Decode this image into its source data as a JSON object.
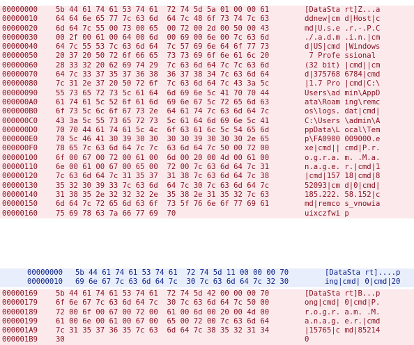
{
  "colors": {
    "pink_bg": "#fbe9ec",
    "pink_text": "#8a1524",
    "blue_bg": "#e8eefb",
    "blue_text": "#0a1f86"
  },
  "blocks": [
    {
      "style": "pink",
      "rows": [
        {
          "offset": "00000000",
          "bytes": "5b 44 61 74 61 53 74 61  72 74 5d 5a 01 00 00 61",
          "ascii": "[DataSta rt]Z...a"
        },
        {
          "offset": "00000010",
          "bytes": "64 64 6e 65 77 7c 63 6d  64 7c 48 6f 73 74 7c 63",
          "ascii": "ddnew|cm d|Host|c"
        },
        {
          "offset": "00000020",
          "bytes": "6d 64 7c 55 00 73 00 65  00 72 00 2d 00 50 00 43",
          "ascii": "md|U.s.e .r.-.P.C"
        },
        {
          "offset": "00000030",
          "bytes": "00 2f 00 61 00 64 00 6d  00 69 00 6e 00 7c 63 6d",
          "ascii": "./.a.d.m .i.n.|cm"
        },
        {
          "offset": "00000040",
          "bytes": "64 7c 55 53 7c 63 6d 64  7c 57 69 6e 64 6f 77 73",
          "ascii": "d|US|cmd |Windows"
        },
        {
          "offset": "00000050",
          "bytes": "20 37 20 50 72 6f 66 65  73 73 69 6f 6e 61 6c 20",
          "ascii": " 7 Profe ssional "
        },
        {
          "offset": "00000060",
          "bytes": "28 33 32 20 62 69 74 29  7c 63 6d 64 7c 7c 63 6d",
          "ascii": "(32 bit) |cmd||cm"
        },
        {
          "offset": "00000070",
          "bytes": "64 7c 33 37 35 37 36 38  36 37 38 34 7c 63 6d 64",
          "ascii": "d|375768 6784|cmd"
        },
        {
          "offset": "00000080",
          "bytes": "7c 31 2e 37 20 50 72 6f  7c 63 6d 64 7c 43 3a 5c",
          "ascii": "|1.7 Pro |cmd|C:\\"
        },
        {
          "offset": "00000090",
          "bytes": "55 73 65 72 73 5c 61 64  6d 69 6e 5c 41 70 70 44",
          "ascii": "Users\\ad min\\AppD"
        },
        {
          "offset": "000000A0",
          "bytes": "61 74 61 5c 52 6f 61 6d  69 6e 67 5c 72 65 6d 63",
          "ascii": "ata\\Roam ing\\remc"
        },
        {
          "offset": "000000B0",
          "bytes": "6f 73 5c 6c 6f 67 73 2e  64 61 74 7c 63 6d 64 7c",
          "ascii": "os\\logs. dat|cmd|"
        },
        {
          "offset": "000000C0",
          "bytes": "43 3a 5c 55 73 65 72 73  5c 61 64 6d 69 6e 5c 41",
          "ascii": "C:\\Users \\admin\\A"
        },
        {
          "offset": "000000D0",
          "bytes": "70 70 44 61 74 61 5c 4c  6f 63 61 6c 5c 54 65 6d",
          "ascii": "ppData\\L ocal\\Tem"
        },
        {
          "offset": "000000E0",
          "bytes": "70 5c 46 41 30 39 30 30  30 30 39 30 30 30 2e 65",
          "ascii": "p\\FA0900 009000.e"
        },
        {
          "offset": "000000F0",
          "bytes": "78 65 7c 63 6d 64 7c 7c  63 6d 64 7c 50 00 72 00",
          "ascii": "xe|cmd|| cmd|P.r."
        },
        {
          "offset": "00000100",
          "bytes": "6f 00 67 00 72 00 61 00  6d 00 20 00 4d 00 61 00",
          "ascii": "o.g.r.a. m. .M.a."
        },
        {
          "offset": "00000110",
          "bytes": "6e 00 61 00 67 00 65 00  72 00 7c 63 6d 64 7c 31",
          "ascii": "n.a.g.e. r.|cmd|1"
        },
        {
          "offset": "00000120",
          "bytes": "7c 63 6d 64 7c 31 35 37  31 38 7c 63 6d 64 7c 38",
          "ascii": "|cmd|157 18|cmd|8"
        },
        {
          "offset": "00000130",
          "bytes": "35 32 30 39 33 7c 63 6d  64 7c 30 7c 63 6d 64 7c",
          "ascii": "52093|cm d|0|cmd|"
        },
        {
          "offset": "00000140",
          "bytes": "31 38 35 2e 32 32 32 2e  35 38 2e 31 35 32 7c 63",
          "ascii": "185.222. 58.152|c"
        },
        {
          "offset": "00000150",
          "bytes": "6d 64 7c 72 65 6d 63 6f  73 5f 76 6e 6f 77 69 61",
          "ascii": "md|remco s_vnowia"
        },
        {
          "offset": "00000160",
          "bytes": "75 69 78 63 7a 66 77 69  70",
          "ascii": "uixczfwi p"
        }
      ]
    },
    {
      "style": "blue",
      "rows": [
        {
          "offset": "00000000",
          "bytes": "5b 44 61 74 61 53 74 61  72 74 5d 11 00 00 00 70",
          "ascii": "[DataSta rt]....p"
        },
        {
          "offset": "00000010",
          "bytes": "69 6e 67 7c 63 6d 64 7c  30 7c 63 6d 64 7c 32 30",
          "ascii": "ing|cmd| 0|cmd|20"
        }
      ]
    },
    {
      "style": "pink",
      "rows": [
        {
          "offset": "00000169",
          "bytes": "5b 44 61 74 61 53 74 61  72 74 5d 42 00 00 00 70",
          "ascii": "[DataSta rt]B...p"
        },
        {
          "offset": "00000179",
          "bytes": "6f 6e 67 7c 63 6d 64 7c  30 7c 63 6d 64 7c 50 00",
          "ascii": "ong|cmd| 0|cmd|P."
        },
        {
          "offset": "00000189",
          "bytes": "72 00 6f 00 67 00 72 00  61 00 6d 00 20 00 4d 00",
          "ascii": "r.o.g.r. a.m. .M."
        },
        {
          "offset": "00000199",
          "bytes": "61 00 6e 00 61 00 67 00  65 00 72 00 7c 63 6d 64",
          "ascii": "a.n.a.g. e.r.|cmd"
        },
        {
          "offset": "000001A9",
          "bytes": "7c 31 35 37 36 35 7c 63  6d 64 7c 38 35 32 31 34",
          "ascii": "|15765|c md|85214"
        },
        {
          "offset": "000001B9",
          "bytes": "30",
          "ascii": "0"
        }
      ]
    }
  ]
}
